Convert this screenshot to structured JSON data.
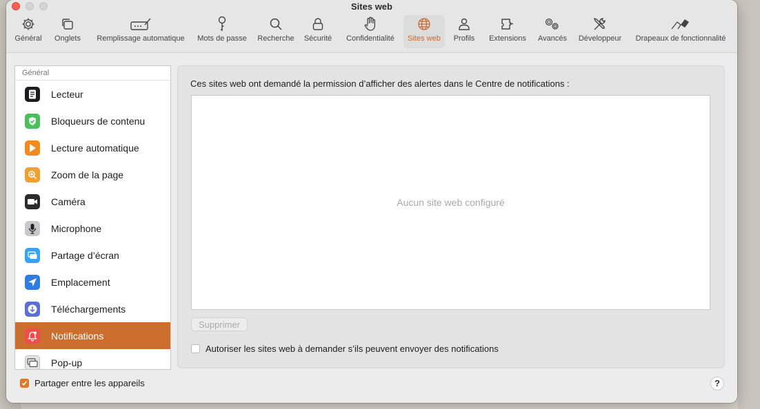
{
  "window": {
    "title": "Sites web"
  },
  "toolbar": {
    "items": [
      {
        "label": "Général",
        "icon": "gear-icon"
      },
      {
        "label": "Onglets",
        "icon": "tabs-icon"
      },
      {
        "label": "Remplissage automatique",
        "icon": "autofill-icon"
      },
      {
        "label": "Mots de passe",
        "icon": "key-icon"
      },
      {
        "label": "Recherche",
        "icon": "search-icon"
      },
      {
        "label": "Sécurité",
        "icon": "lock-icon"
      },
      {
        "label": "Confidentialité",
        "icon": "hand-icon"
      },
      {
        "label": "Sites web",
        "icon": "globe-icon"
      },
      {
        "label": "Profils",
        "icon": "person-icon"
      },
      {
        "label": "Extensions",
        "icon": "puzzle-icon"
      },
      {
        "label": "Avancés",
        "icon": "gears-icon"
      },
      {
        "label": "Développeur",
        "icon": "tools-icon"
      },
      {
        "label": "Drapeaux de fonctionnalité",
        "icon": "flags-icon"
      }
    ],
    "active_color": "#c86a2a"
  },
  "sidebar": {
    "header": "Général",
    "items": [
      {
        "label": "Lecteur",
        "icon": "reader-icon",
        "color": "#1c1c1e"
      },
      {
        "label": "Bloqueurs de contenu",
        "icon": "content-blocker-icon",
        "color": "#4cbf5c"
      },
      {
        "label": "Lecture automatique",
        "icon": "autoplay-icon",
        "color": "#f28a1e"
      },
      {
        "label": "Zoom de la page",
        "icon": "zoom-icon",
        "color": "#f0a030"
      },
      {
        "label": "Caméra",
        "icon": "camera-icon",
        "color": "#2c2c2e"
      },
      {
        "label": "Microphone",
        "icon": "microphone-icon",
        "color": "#c8c8cc"
      },
      {
        "label": "Partage d’écran",
        "icon": "screen-share-icon",
        "color": "#3aa3f0"
      },
      {
        "label": "Emplacement",
        "icon": "location-icon",
        "color": "#2f7de1"
      },
      {
        "label": "Téléchargements",
        "icon": "downloads-icon",
        "color": "#5a6fd8"
      },
      {
        "label": "Notifications",
        "icon": "notifications-icon",
        "color": "#ef4c4c"
      },
      {
        "label": "Pop-up",
        "icon": "popup-icon",
        "color": "#d8d8d8"
      }
    ],
    "selected_color": "#cc6e2d"
  },
  "main": {
    "description": "Ces sites web ont demandé la permission d’afficher des alertes dans le Centre de notifications :",
    "empty_text": "Aucun site web configuré",
    "remove_label": "Supprimer",
    "allow_label": "Autoriser les sites web à demander s’ils peuvent envoyer des notifications"
  },
  "footer": {
    "share_label": "Partager entre les appareils",
    "help_label": "?"
  }
}
